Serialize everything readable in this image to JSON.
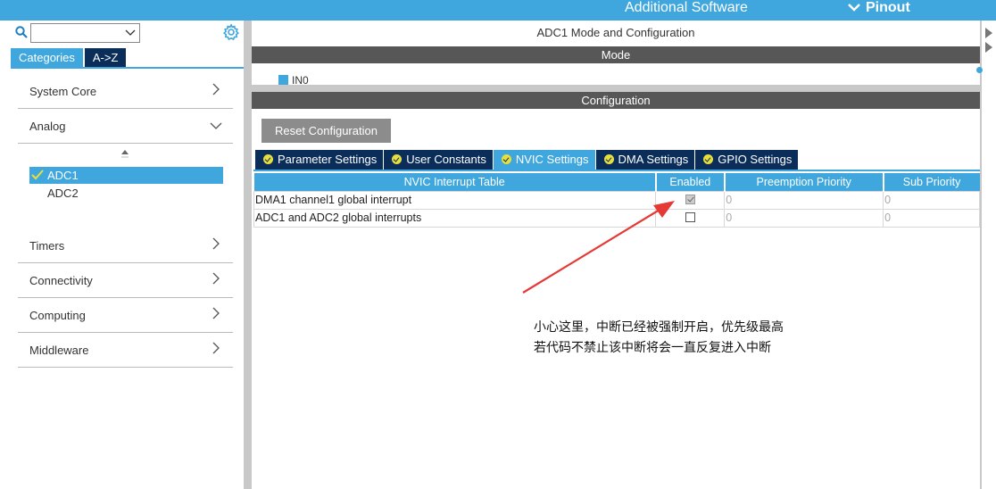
{
  "topbar": {
    "additional_software": "Additional Software",
    "pinout": "Pinout"
  },
  "sidebar": {
    "search_value": "",
    "tabs": [
      {
        "label": "Categories"
      },
      {
        "label": "A->Z"
      }
    ],
    "categories": [
      {
        "label": "System Core"
      },
      {
        "label": "Analog"
      },
      {
        "label": "Timers"
      },
      {
        "label": "Connectivity"
      },
      {
        "label": "Computing"
      },
      {
        "label": "Middleware"
      }
    ],
    "analog_items": [
      {
        "label": "ADC1"
      },
      {
        "label": "ADC2"
      }
    ]
  },
  "main": {
    "title": "ADC1 Mode and Configuration",
    "mode_header": "Mode",
    "mode_in0": "IN0",
    "config_header": "Configuration",
    "reset_button": "Reset Configuration",
    "tabs": [
      {
        "label": "Parameter Settings"
      },
      {
        "label": "User Constants"
      },
      {
        "label": "NVIC Settings"
      },
      {
        "label": "DMA Settings"
      },
      {
        "label": "GPIO Settings"
      }
    ],
    "table": {
      "headers": [
        "NVIC Interrupt Table",
        "Enabled",
        "Preemption Priority",
        "Sub Priority"
      ],
      "rows": [
        {
          "name": "DMA1 channel1 global interrupt",
          "enabled": true,
          "preemption": "0",
          "sub": "0"
        },
        {
          "name": "ADC1 and ADC2 global interrupts",
          "enabled": false,
          "preemption": "0",
          "sub": "0"
        }
      ]
    }
  },
  "annotation": {
    "line1": "小心这里，中断已经被强制开启，优先级最高",
    "line2": "若代码不禁止该中断将会一直反复进入中断"
  },
  "colors": {
    "accent": "#3fa7dd",
    "dark_navy": "#0b2d5a",
    "header_gray": "#575757",
    "arrow_red": "#e53935"
  }
}
